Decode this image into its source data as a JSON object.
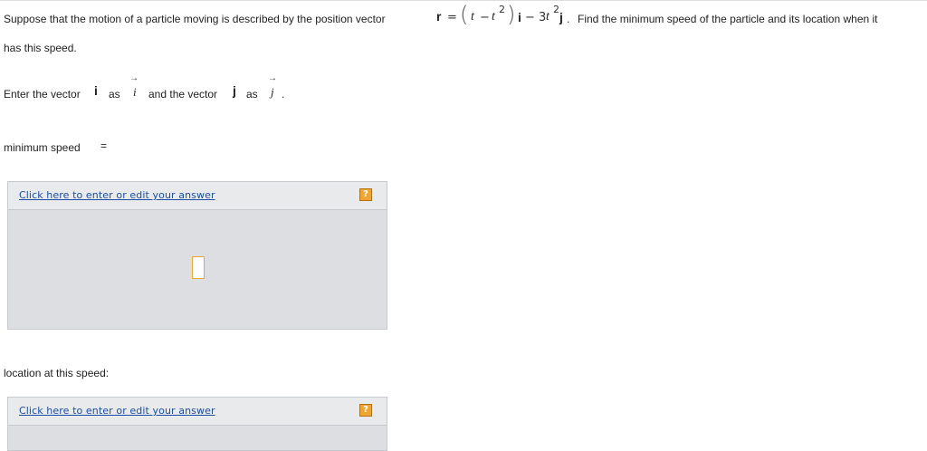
{
  "problem": {
    "intro": "Suppose that the motion of a particle moving is described by the position vector",
    "r_symbol": "r",
    "equals": "=",
    "expr_open": "(",
    "expr_t": "t",
    "expr_minus": "−",
    "expr_t2": "t",
    "expr_exp": "2",
    "expr_close": ")",
    "i_vec": "i",
    "minus2": "− 3",
    "t3": "t",
    "exp3": "2",
    "j_vec": "j",
    "period": ".",
    "find": "Find the minimum speed of the particle and its location when it",
    "line2": "has this speed."
  },
  "instructions": {
    "enter_the_vector": "Enter the vector",
    "i_bold": "i",
    "as1": "as",
    "i_italic": "i",
    "and_the_vector": "and the vector",
    "j_bold": "j",
    "as2": "as",
    "j_italic": "j",
    "period": ".",
    "arrow": "→"
  },
  "fields": {
    "minimum_speed_label": "minimum speed",
    "minimum_speed_equals": "=",
    "location_label": "location at this speed:"
  },
  "answer_boxes": [
    {
      "link_text": "Click here to enter or edit your answer",
      "help_icon": "?"
    },
    {
      "link_text": "Click here to enter or edit your answer",
      "help_icon": "?"
    }
  ],
  "colors": {
    "link": "#1b4ea3",
    "help_icon": "#f0a530",
    "box_bg": "#dcdee1",
    "box_header_bg": "#e9eaec"
  }
}
